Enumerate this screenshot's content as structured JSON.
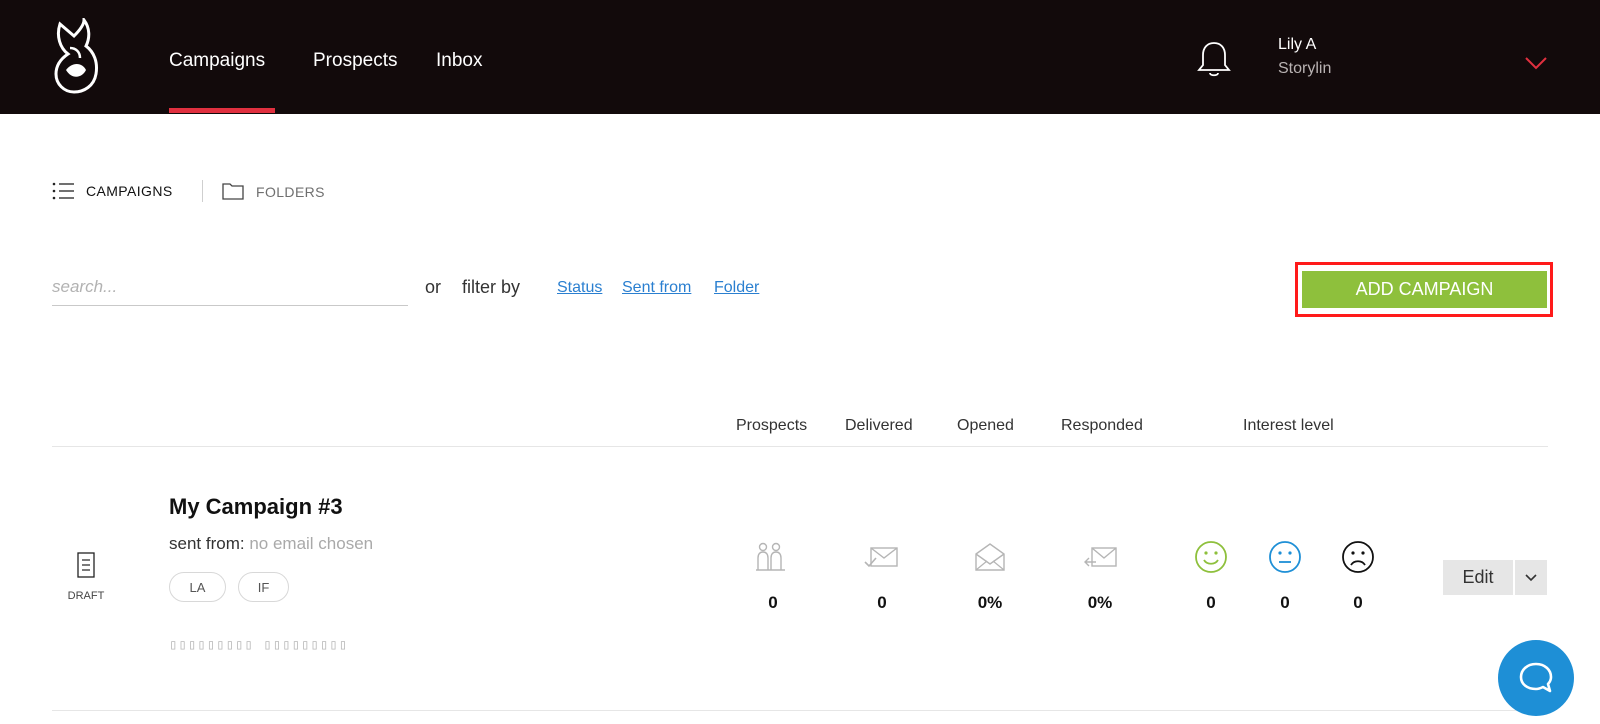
{
  "header": {
    "nav": [
      "Campaigns",
      "Prospects",
      "Inbox"
    ],
    "active_nav": "Campaigns",
    "user": {
      "name": "Lily A",
      "org": "Storylin"
    }
  },
  "view_toggle": {
    "campaigns_label": "CAMPAIGNS",
    "folders_label": "FOLDERS"
  },
  "filters": {
    "search_placeholder": "search...",
    "or_label": "or",
    "filter_by_label": "filter by",
    "links": [
      "Status",
      "Sent from",
      "Folder"
    ]
  },
  "add_button_label": "ADD CAMPAIGN",
  "table": {
    "columns": [
      "Prospects",
      "Delivered",
      "Opened",
      "Responded",
      "Interest level"
    ]
  },
  "campaign": {
    "status": "DRAFT",
    "name": "My Campaign #3",
    "sent_from_label": "sent from:",
    "sent_from_value": "no email chosen",
    "tags": [
      "LA",
      "IF"
    ],
    "placeholder_glyphs": "▯▯▯▯▯▯▯▯▯ ▯▯▯▯▯▯▯▯▯",
    "stats": {
      "prospects": "0",
      "delivered": "0",
      "opened": "0%",
      "responded": "0%"
    },
    "interest": {
      "positive": "0",
      "neutral": "0",
      "negative": "0"
    },
    "edit_label": "Edit"
  },
  "colors": {
    "header_bg": "#120a0b",
    "accent_red": "#e0303f",
    "add_green": "#8ec03c",
    "link_blue": "#2a7fd0",
    "positive": "#8ec03c",
    "neutral": "#1e8fd6",
    "negative": "#111111",
    "chat_blue": "#1e8fd6"
  },
  "icons": [
    "logo-icon",
    "bell-icon",
    "chevron-down-icon",
    "list-icon",
    "folder-icon",
    "document-icon",
    "users-icon",
    "delivered-icon",
    "opened-icon",
    "responded-icon",
    "smile-icon",
    "neutral-face-icon",
    "sad-face-icon",
    "chat-icon"
  ]
}
